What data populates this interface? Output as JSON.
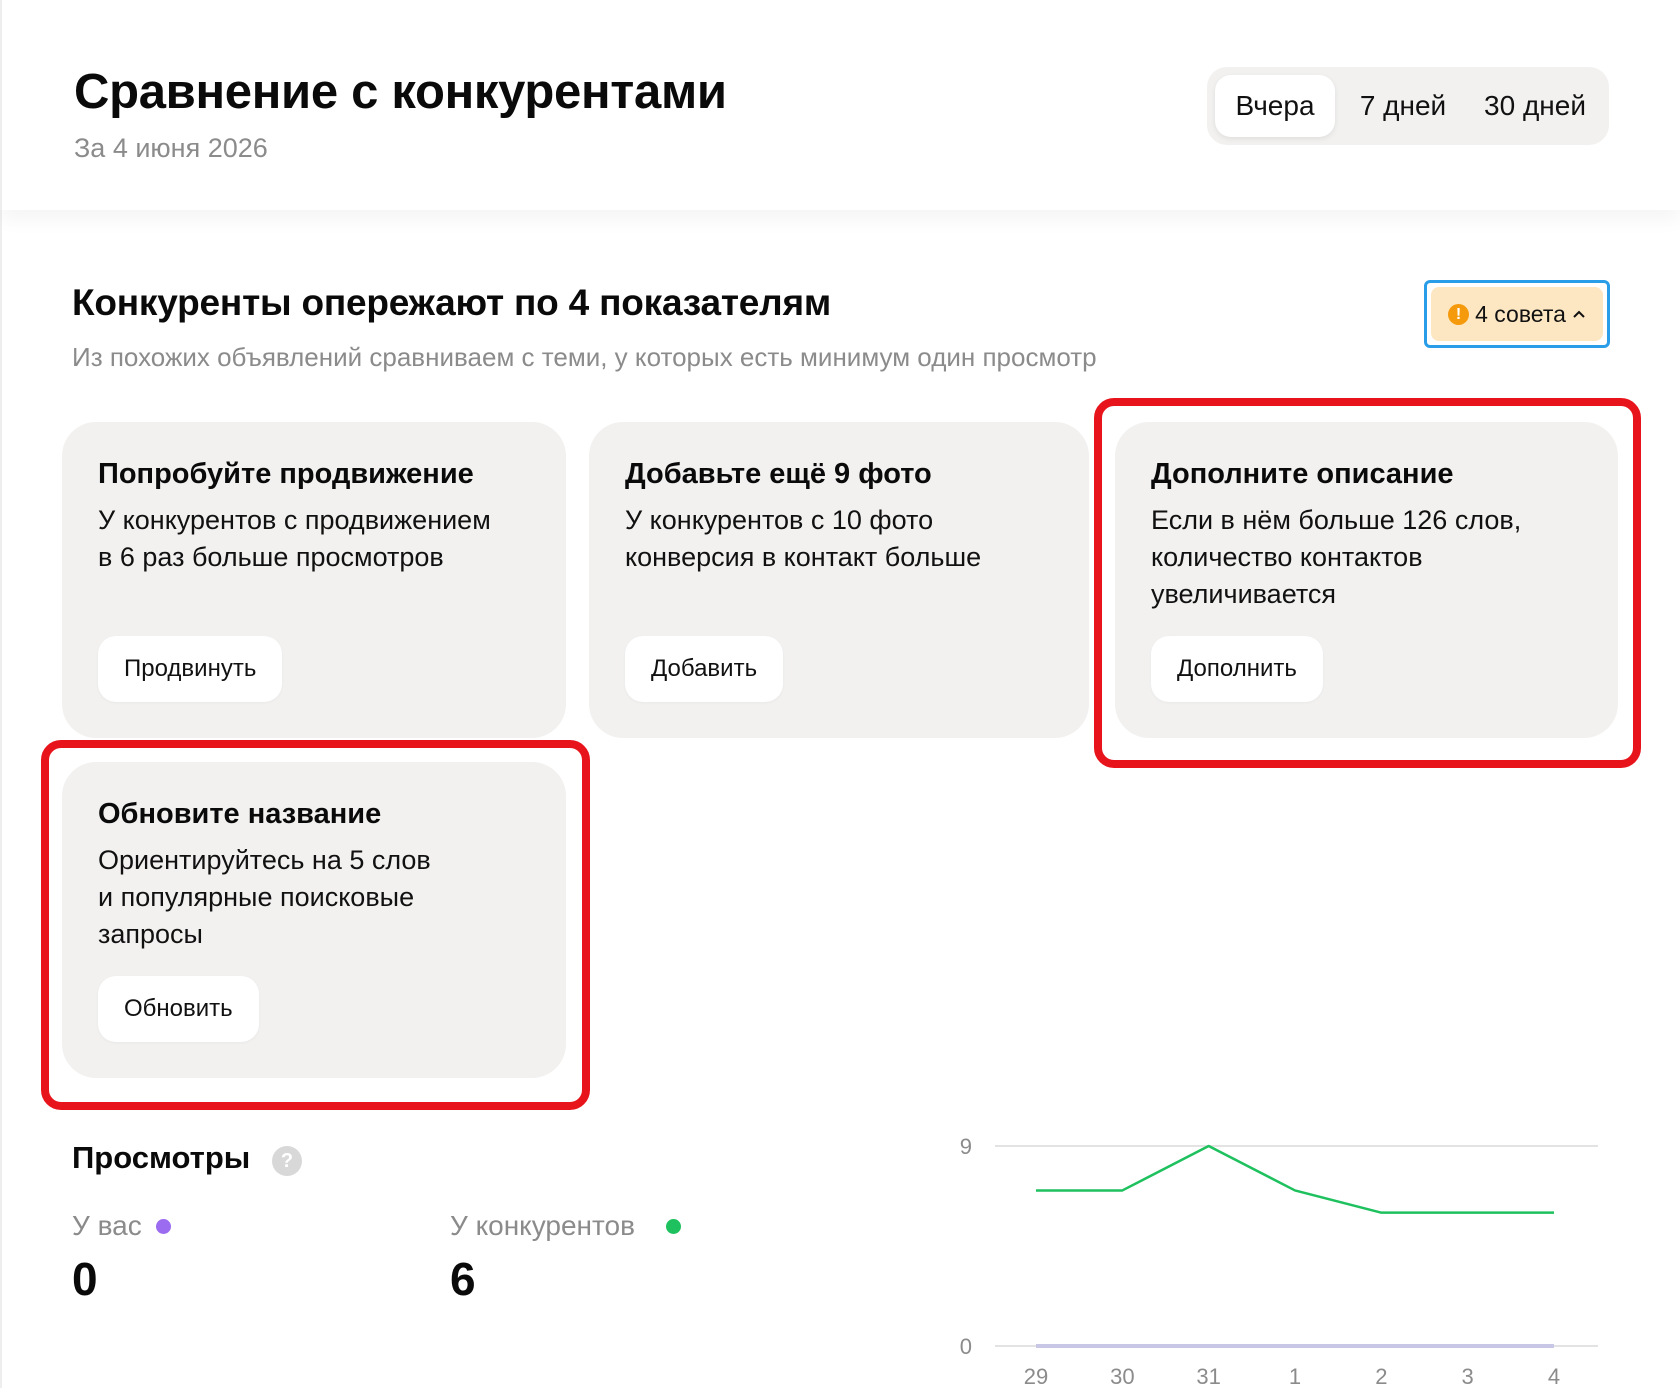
{
  "header": {
    "title": "Сравнение с конкурентами",
    "date": "За 4 июня 2026",
    "periods": [
      {
        "label": "Вчера",
        "active": true
      },
      {
        "label": "7 дней",
        "active": false
      },
      {
        "label": "30 дней",
        "active": false
      }
    ]
  },
  "section": {
    "title": "Конкуренты опережают по 4 показателям",
    "subtitle": "Из похожих объявлений сравниваем с теми, у которых есть минимум один просмотр",
    "tips_badge": {
      "label": "4 совета",
      "icon": "warning-icon",
      "color": "#fde7c2"
    }
  },
  "cards": [
    {
      "title": "Попробуйте продвижение",
      "desc_line1": "У конкурентов с продвижением",
      "desc_line2": "в 6 раз больше просмотров",
      "button": "Продвинуть",
      "highlighted": false
    },
    {
      "title": "Добавьте ещё 9 фото",
      "desc_line1": "У конкурентов с 10 фото",
      "desc_line2": "конверсия в контакт больше",
      "button": "Добавить",
      "highlighted": false
    },
    {
      "title": "Дополните описание",
      "desc_line1": "Если в нём больше 126 слов,",
      "desc_line2": "количество контактов",
      "desc_line3": "увеличивается",
      "button": "Дополнить",
      "highlighted": true
    },
    {
      "title": "Обновите название",
      "desc_line1": "Ориентируйтесь на 5 слов",
      "desc_line2": "и популярные поисковые",
      "desc_line3": "запросы",
      "button": "Обновить",
      "highlighted": true
    }
  ],
  "views": {
    "title": "Просмотры",
    "help_icon": "question-icon",
    "you": {
      "label": "У вас",
      "value": "0",
      "color": "#9b6cf0"
    },
    "competitors": {
      "label": "У конкурентов",
      "value": "6",
      "color": "#1ec15e"
    }
  },
  "colors": {
    "card_bg": "#f2f1f0",
    "highlight": "#e8141c",
    "accent_border": "#2a9de8"
  },
  "chart_data": {
    "type": "line",
    "categories": [
      "29",
      "30",
      "31",
      "1",
      "2",
      "3",
      "4"
    ],
    "series": [
      {
        "name": "У конкурентов",
        "color": "#1ec15e",
        "values": [
          7,
          7,
          9,
          7,
          6,
          6,
          6
        ]
      },
      {
        "name": "У вас",
        "color": "#c9c7e6",
        "values": [
          0,
          0,
          0,
          0,
          0,
          0,
          0
        ]
      }
    ],
    "yticks": [
      "9",
      "0"
    ],
    "ylim": [
      0,
      9
    ],
    "grid": true
  }
}
